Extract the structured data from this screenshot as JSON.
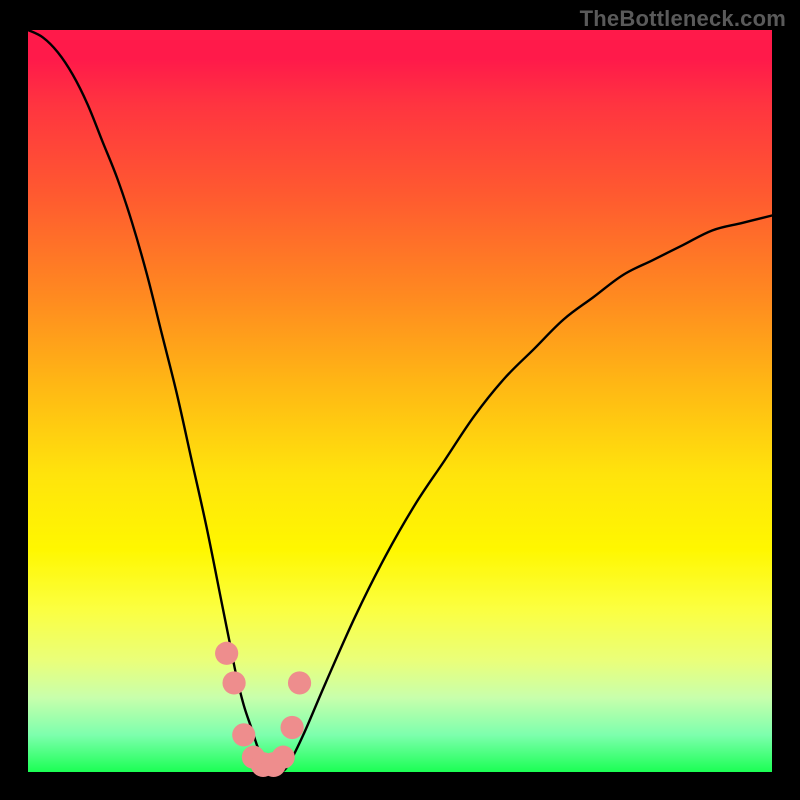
{
  "watermark": {
    "text": "TheBottleneck.com"
  },
  "chart_data": {
    "type": "line",
    "title": "",
    "xlabel": "",
    "ylabel": "",
    "xlim": [
      0,
      100
    ],
    "ylim": [
      0,
      100
    ],
    "series": [
      {
        "name": "bottleneck-curve",
        "x": [
          0,
          2,
          4,
          6,
          8,
          10,
          12,
          14,
          16,
          18,
          20,
          22,
          24,
          26,
          27,
          28,
          29,
          30,
          31,
          32,
          33,
          34,
          35,
          37,
          40,
          44,
          48,
          52,
          56,
          60,
          64,
          68,
          72,
          76,
          80,
          84,
          88,
          92,
          96,
          100
        ],
        "values": [
          100,
          99,
          97,
          94,
          90,
          85,
          80,
          74,
          67,
          59,
          51,
          42,
          33,
          23,
          18,
          13,
          9,
          6,
          3,
          1,
          0,
          0,
          1,
          5,
          12,
          21,
          29,
          36,
          42,
          48,
          53,
          57,
          61,
          64,
          67,
          69,
          71,
          73,
          74,
          75
        ]
      }
    ],
    "markers": [
      {
        "name": "dot-left-upper",
        "x": 26.7,
        "y": 16,
        "r": 1.4
      },
      {
        "name": "dot-left-lower",
        "x": 27.7,
        "y": 12,
        "r": 1.4
      },
      {
        "name": "dot-bottom-1",
        "x": 29.0,
        "y": 5,
        "r": 1.4
      },
      {
        "name": "dot-bottom-2",
        "x": 30.3,
        "y": 2,
        "r": 1.4
      },
      {
        "name": "dot-bottom-3",
        "x": 31.6,
        "y": 1,
        "r": 1.6
      },
      {
        "name": "dot-bottom-4",
        "x": 33.0,
        "y": 1,
        "r": 1.6
      },
      {
        "name": "dot-bottom-5",
        "x": 34.3,
        "y": 2,
        "r": 1.4
      },
      {
        "name": "dot-right-lower",
        "x": 35.5,
        "y": 6,
        "r": 1.4
      },
      {
        "name": "dot-right-upper",
        "x": 36.5,
        "y": 12,
        "r": 1.4
      }
    ],
    "colors": {
      "curve": "#000000",
      "markers": "#ee8d8d",
      "gradient_top": "#ff1a4a",
      "gradient_mid": "#fff700",
      "gradient_bottom": "#1bff54"
    }
  }
}
